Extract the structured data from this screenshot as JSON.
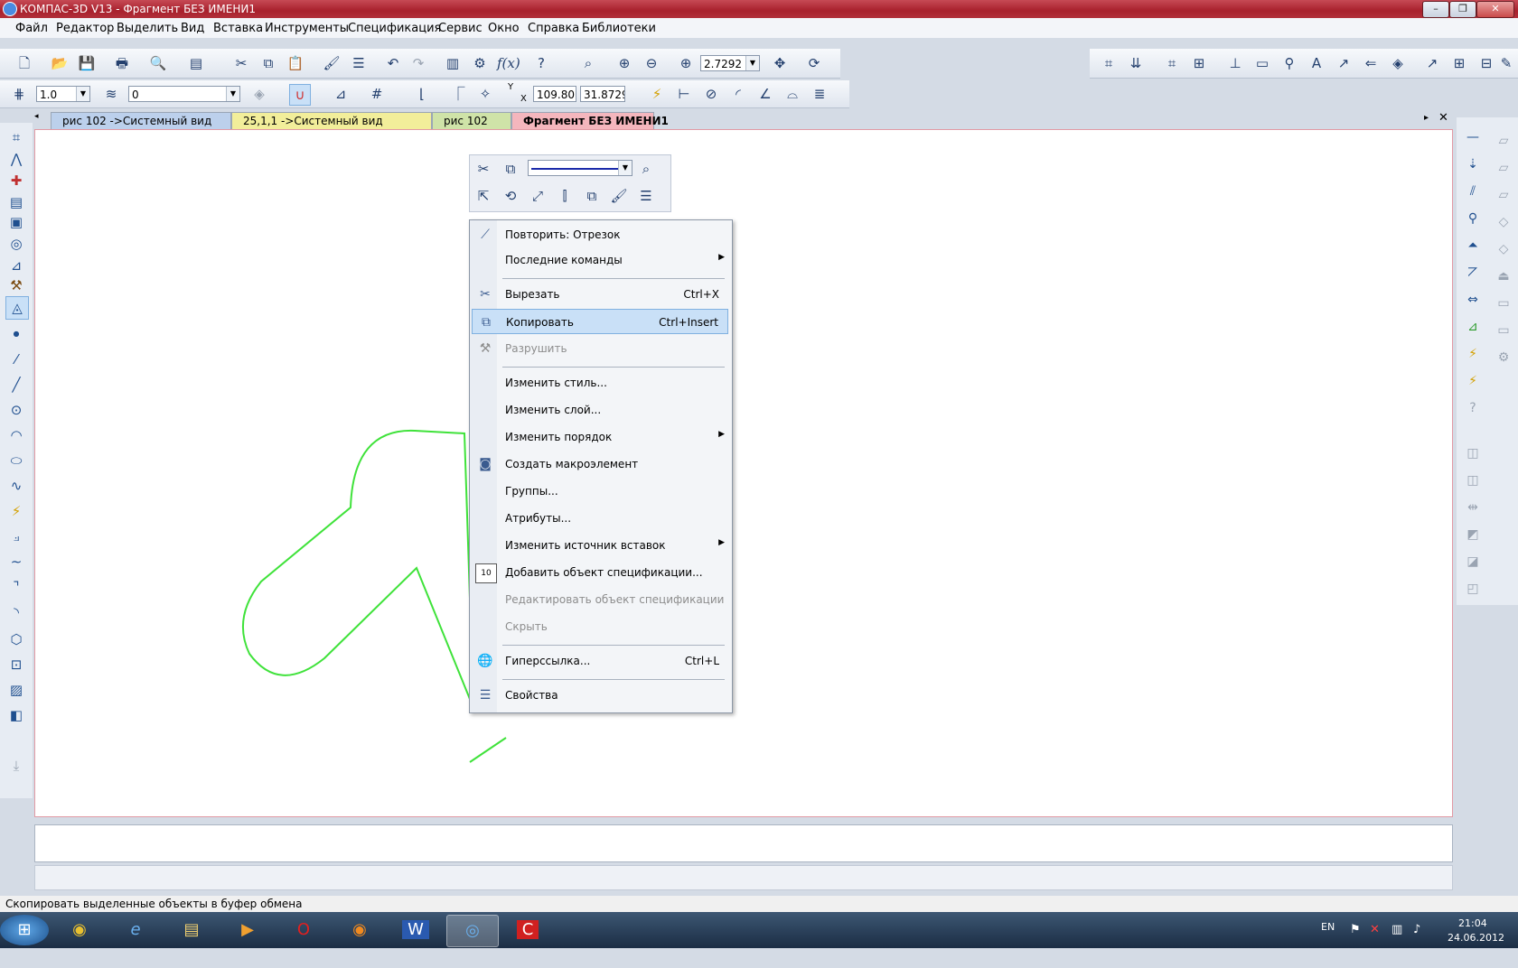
{
  "window": {
    "title": "КОМПАС-3D V13 - Фрагмент БЕЗ ИМЕНИ1",
    "controls": [
      "–",
      "❐",
      "✕"
    ]
  },
  "menu": [
    "Файл",
    "Редактор",
    "Выделить",
    "Вид",
    "Вставка",
    "Инструменты",
    "Спецификация",
    "Сервис",
    "Окно",
    "Справка",
    "Библиотеки"
  ],
  "toolbar": {
    "zoom_value": "2.7292",
    "line_step": "1.0",
    "layer": "0",
    "coord_y_label": "Y",
    "coord_x_label": "X",
    "coord_x": "109.80",
    "coord_y": "31.8729"
  },
  "tabs": [
    {
      "label": "рис 102 ->Системный вид",
      "color": "#bcd0ec"
    },
    {
      "label": "25,1,1 ->Системный вид",
      "color": "#f2ee9a"
    },
    {
      "label": "рис 102",
      "color": "#cfe3a8"
    },
    {
      "label": "Фрагмент БЕЗ ИМЕНИ1",
      "color": "#f4b6bd"
    }
  ],
  "context_menu": {
    "items": [
      {
        "label": "Повторить: Отрезок",
        "shortcut": "",
        "submenu": false,
        "disabled": false,
        "icon": "line-icon"
      },
      {
        "label": "Последние команды",
        "shortcut": "",
        "submenu": true,
        "disabled": false,
        "icon": ""
      },
      {
        "label": "Вырезать",
        "shortcut": "Ctrl+X",
        "submenu": false,
        "disabled": false,
        "icon": "scissors-icon"
      },
      {
        "label": "Копировать",
        "shortcut": "Ctrl+Insert",
        "submenu": false,
        "disabled": false,
        "icon": "copy-icon",
        "highlighted": true
      },
      {
        "label": "Разрушить",
        "shortcut": "",
        "submenu": false,
        "disabled": true,
        "icon": "destroy-icon"
      },
      {
        "label": "Изменить стиль...",
        "shortcut": "",
        "submenu": false,
        "disabled": false,
        "icon": ""
      },
      {
        "label": "Изменить слой...",
        "shortcut": "",
        "submenu": false,
        "disabled": false,
        "icon": ""
      },
      {
        "label": "Изменить порядок",
        "shortcut": "",
        "submenu": true,
        "disabled": false,
        "icon": ""
      },
      {
        "label": "Создать макроэлемент",
        "shortcut": "",
        "submenu": false,
        "disabled": false,
        "icon": "macro-icon"
      },
      {
        "label": "Группы...",
        "shortcut": "",
        "submenu": false,
        "disabled": false,
        "icon": ""
      },
      {
        "label": "Атрибуты...",
        "shortcut": "",
        "submenu": false,
        "disabled": false,
        "icon": ""
      },
      {
        "label": "Изменить источник вставок",
        "shortcut": "",
        "submenu": true,
        "disabled": false,
        "icon": ""
      },
      {
        "label": "Добавить объект спецификации...",
        "shortcut": "",
        "submenu": false,
        "disabled": false,
        "icon": "spec-add-icon"
      },
      {
        "label": "Редактировать объект спецификации",
        "shortcut": "",
        "submenu": false,
        "disabled": true,
        "icon": ""
      },
      {
        "label": "Скрыть",
        "shortcut": "",
        "submenu": false,
        "disabled": true,
        "icon": ""
      },
      {
        "label": "Гиперссылка...",
        "shortcut": "Ctrl+L",
        "submenu": false,
        "disabled": false,
        "icon": "hyperlink-icon"
      },
      {
        "label": "Свойства",
        "shortcut": "",
        "submenu": false,
        "disabled": false,
        "icon": "properties-icon"
      }
    ],
    "spec_icon_text": "10"
  },
  "status_text": "Скопировать выделенные объекты в буфер обмена",
  "taskbar": {
    "language": "EN",
    "time": "21:04",
    "date": "24.06.2012"
  },
  "colors": {
    "drawing_line": "#3fe23a",
    "highlight": "#c9e0f7",
    "title_bar": "#b0303a"
  }
}
